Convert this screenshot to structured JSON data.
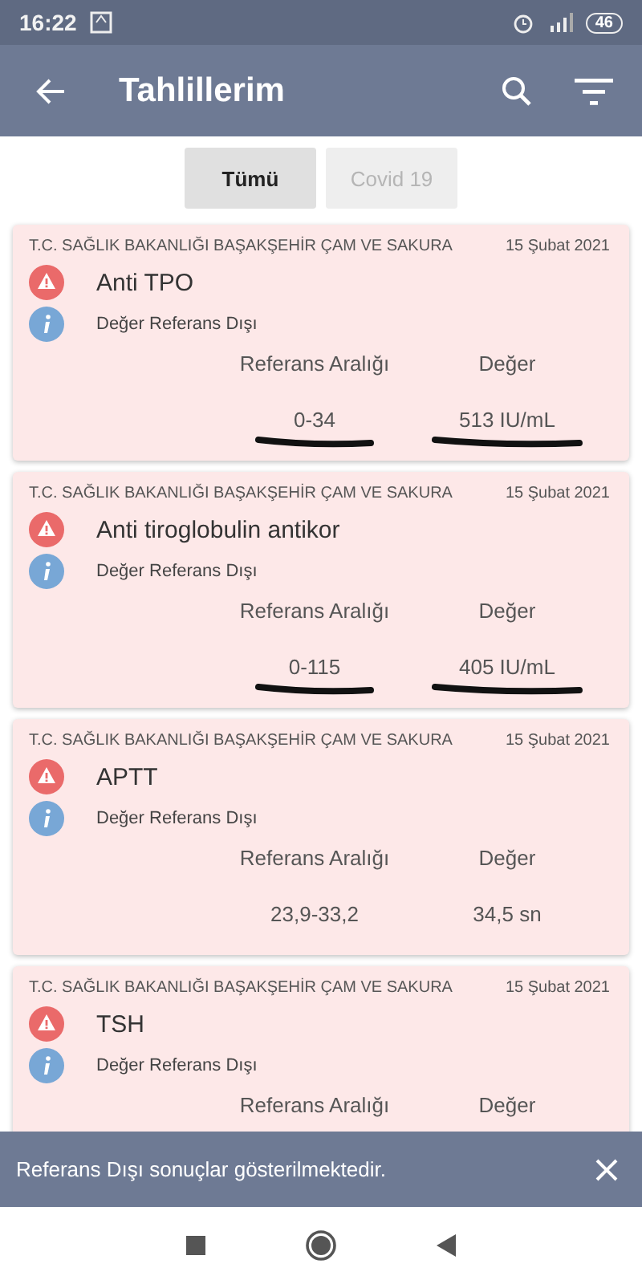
{
  "status_bar": {
    "time": "16:22",
    "battery": "46"
  },
  "app_bar": {
    "title": "Tahlillerim"
  },
  "filters": [
    {
      "label": "Tümü",
      "selected": true
    },
    {
      "label": "Covid 19",
      "selected": false
    }
  ],
  "results": [
    {
      "institution": "T.C. SAĞLIK BAKANLIĞI BAŞAKŞEHİR ÇAM VE SAKURA",
      "date": "15 Şubat 2021",
      "test": "Anti TPO",
      "status": "Değer Referans Dışı",
      "range_label": "Referans Aralığı",
      "value_label": "Değer",
      "range": "0-34",
      "value": "513 IU/mL",
      "underlined": true
    },
    {
      "institution": "T.C. SAĞLIK BAKANLIĞI BAŞAKŞEHİR ÇAM VE SAKURA",
      "date": "15 Şubat 2021",
      "test": "Anti tiroglobulin antikor",
      "status": "Değer Referans Dışı",
      "range_label": "Referans Aralığı",
      "value_label": "Değer",
      "range": "0-115",
      "value": "405 IU/mL",
      "underlined": true
    },
    {
      "institution": "T.C. SAĞLIK BAKANLIĞI BAŞAKŞEHİR ÇAM VE SAKURA",
      "date": "15 Şubat 2021",
      "test": "APTT",
      "status": "Değer Referans Dışı",
      "range_label": "Referans Aralığı",
      "value_label": "Değer",
      "range": "23,9-33,2",
      "value": "34,5 sn",
      "underlined": false
    },
    {
      "institution": "T.C. SAĞLIK BAKANLIĞI BAŞAKŞEHİR ÇAM VE SAKURA",
      "date": "15 Şubat 2021",
      "test": "TSH",
      "status": "Değer Referans Dışı",
      "range_label": "Referans Aralığı",
      "value_label": "Değer"
    }
  ],
  "snackbar": {
    "message": "Referans Dışı sonuçlar gösterilmektedir."
  }
}
